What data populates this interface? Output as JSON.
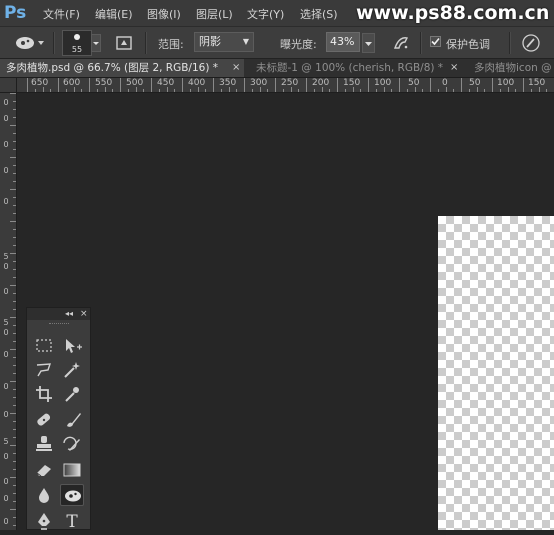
{
  "app": {
    "logo_text": "Ps"
  },
  "menu": {
    "items": [
      "文件(F)",
      "编辑(E)",
      "图像(I)",
      "图层(L)",
      "文字(Y)",
      "选择(S)"
    ],
    "watermark": "www.ps88.com.cn"
  },
  "options": {
    "tool_icon": "sponge-tool-icon",
    "brush_size": "55",
    "range_label": "范围:",
    "range_value": "阴影",
    "exposure_label": "曝光度:",
    "exposure_value": "43%",
    "protect_tones_label": "保护色调",
    "protect_tones_checked": true
  },
  "tabs": [
    {
      "label": "多肉植物.psd @ 66.7% (图层 2, RGB/16) *",
      "active": true,
      "close": "×"
    },
    {
      "label": "未标题-1 @ 100% (cherish, RGB/8) *",
      "active": false,
      "close": "×"
    },
    {
      "label": "多肉植物icon @",
      "active": false
    }
  ],
  "ruler": {
    "horizontal": [
      "650",
      "600",
      "550",
      "500",
      "450",
      "400",
      "350",
      "300",
      "250",
      "200",
      "150",
      "100",
      "50",
      "0",
      "50",
      "100",
      "150"
    ],
    "vertical": [
      "0",
      "0",
      "0",
      "0",
      "0",
      "5",
      "0",
      "0",
      "5",
      "0",
      "0",
      "0",
      "0",
      "5",
      "0",
      "0",
      "0",
      "0"
    ]
  },
  "toolpanel": {
    "collapse_glyph": "◂◂",
    "close_glyph": "×",
    "tools": [
      "rectangular-marquee-icon",
      "move-icon",
      "lasso-icon",
      "magic-wand-icon",
      "crop-icon",
      "eyedropper-icon",
      "healing-brush-icon",
      "brush-icon",
      "clone-stamp-icon",
      "history-brush-icon",
      "eraser-icon",
      "gradient-icon",
      "blur-icon",
      "sponge-icon",
      "pen-icon",
      "type-icon"
    ],
    "type_glyph": "T"
  },
  "colors": {
    "menubar": "#3a3a3a",
    "canvas": "#262626",
    "logo": "#6fb2e8"
  }
}
